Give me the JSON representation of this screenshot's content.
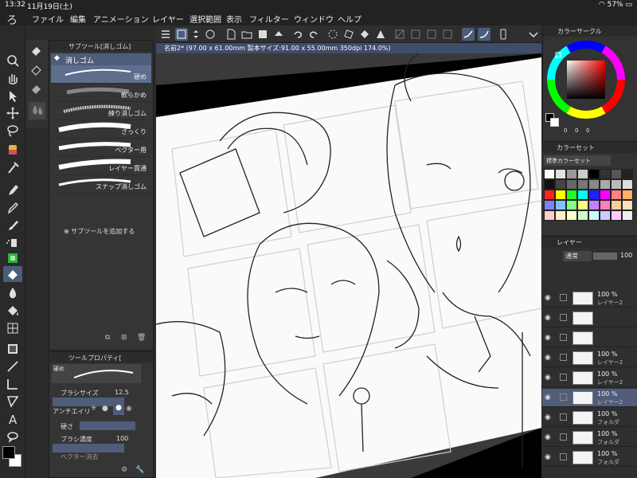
{
  "status": {
    "time": "13:32",
    "date": "11月19日(土)",
    "battery": "57%"
  },
  "menu": [
    "ファイル",
    "編集",
    "アニメーション",
    "レイヤー",
    "選択範囲",
    "表示",
    "フィルター",
    "ウィンドウ",
    "ヘルプ"
  ],
  "subtool": {
    "title": "サブツール[消しゴム]",
    "group": "消しゴム",
    "brushes": [
      {
        "label": "硬め"
      },
      {
        "label": "軟らかめ"
      },
      {
        "label": "練り消しゴム"
      },
      {
        "label": "ざっくり"
      },
      {
        "label": "ベクター用"
      },
      {
        "label": "レイヤー貫通"
      },
      {
        "label": "スナップ消しゴム"
      }
    ],
    "add_label": "サブツールを追加する"
  },
  "toolprop": {
    "title": "ツールプロパティ[",
    "brush_name": "硬め",
    "size_label": "ブラシサイズ",
    "size_value": "12.5",
    "aa_label": "アンチエイリ",
    "hardness_label": "硬さ",
    "density_label": "ブラシ濃度",
    "density_value": "100",
    "vector_label": "ベクター消去"
  },
  "document": {
    "tab": "名前2* (97.00 x 61.00mm 製本サイズ:91.00 x 55.00mm 350dpi 174.0%)"
  },
  "colorwheel": {
    "title": "カラーサークル",
    "hue_value": "0",
    "sat_value": "0",
    "val_value": "0"
  },
  "colorset": {
    "title": "カラーセット",
    "set_name": "標準カラーセット",
    "swatches": [
      "#ffffff",
      "#e0e0e0",
      "#999999",
      "#cccccc",
      "#000000",
      "#333333",
      "#555555",
      "#222222",
      "#111111",
      "#444444",
      "#666666",
      "#777777",
      "#888888",
      "#aaaaaa",
      "#bbbbbb",
      "#dddddd",
      "#ff2020",
      "#ffff00",
      "#20ff20",
      "#00ffff",
      "#2020ff",
      "#ff00ff",
      "#ff8080",
      "#ffb060",
      "#8080ff",
      "#80c0ff",
      "#80ff80",
      "#ffff80",
      "#c080ff",
      "#ff80c0",
      "#ffcc99",
      "#ffe0c0",
      "#ffcccc",
      "#ffeecc",
      "#ffffcc",
      "#ccffcc",
      "#ccffff",
      "#ccccff",
      "#ffccff",
      "#eeeeee"
    ]
  },
  "layers": {
    "title": "レイヤー",
    "blend_mode": "通常",
    "opacity": "100",
    "rows": [
      {
        "pct": "100 %",
        "name": "レイヤー2"
      },
      {
        "pct": "",
        "name": ""
      },
      {
        "pct": "",
        "name": ""
      },
      {
        "pct": "100 %",
        "name": "レイヤー2"
      },
      {
        "pct": "100 %",
        "name": "レイヤー2"
      },
      {
        "pct": "100 %",
        "name": "レイヤー2"
      },
      {
        "pct": "100 %",
        "name": "フォルダ"
      },
      {
        "pct": "100 %",
        "name": "フォルダ"
      },
      {
        "pct": "100 %",
        "name": "フォルダ"
      }
    ]
  }
}
